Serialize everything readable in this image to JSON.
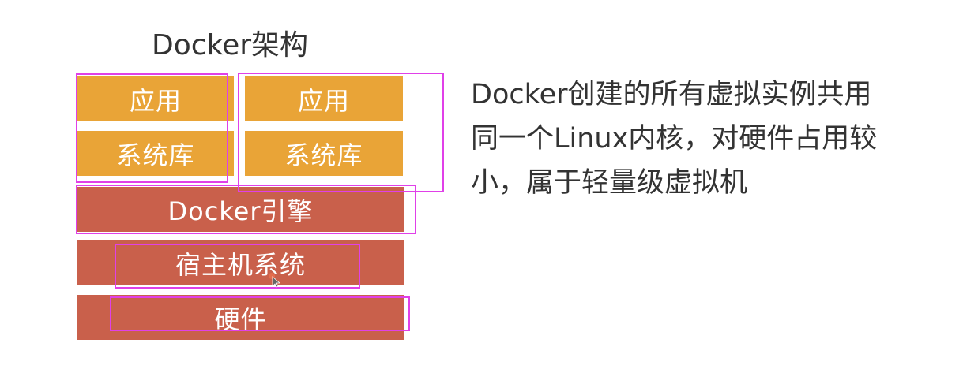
{
  "title": "Docker架构",
  "stack": {
    "left_app": "应用",
    "left_lib": "系统库",
    "right_app": "应用",
    "right_lib": "系统库",
    "engine": "Docker引擎",
    "host_os": "宿主机系统",
    "hardware": "硬件"
  },
  "description": {
    "line1": "Docker创建的所有虚拟实例共用",
    "line2": "同一个Linux内核，对硬件占用较",
    "line3": "小，属于轻量级虚拟机"
  },
  "colors": {
    "orange": "#e9a437",
    "red": "#c9604b",
    "highlight": "#e040e8"
  }
}
